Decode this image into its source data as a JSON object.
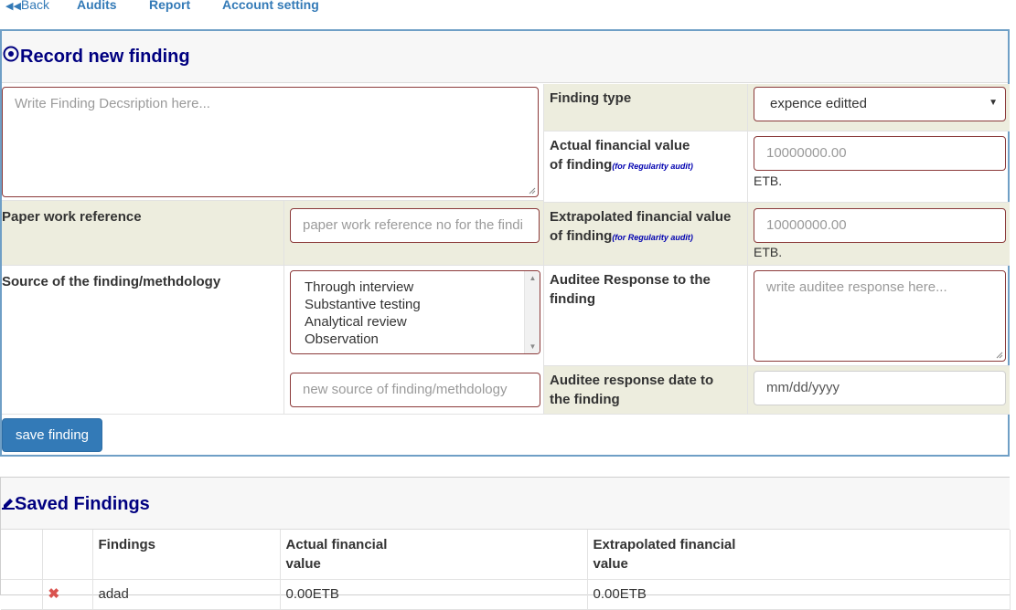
{
  "nav": {
    "back": "Back",
    "items": [
      "Audits",
      "Report",
      "Account setting"
    ]
  },
  "record": {
    "title": "Record new finding",
    "description_placeholder": "Write Finding Decsription here...",
    "finding_type_label": "Finding type",
    "finding_type_value": "expence editted",
    "actual_label_line1": "Actual financial value",
    "actual_label_line2": "of finding",
    "actual_note": "(for Regularity audit)",
    "actual_placeholder": "10000000.00",
    "currency": "ETB.",
    "extrapolated_label_line1": "Extrapolated financial value",
    "extrapolated_label_line2": "of finding",
    "extrapolated_note": "(for Regularity audit)",
    "extrapolated_placeholder": "10000000.00",
    "paper_label": "Paper work reference",
    "paper_placeholder": "paper work reference no for the findi",
    "source_label": "Source of the finding/methdology",
    "source_options": [
      "Through interview",
      "Substantive testing",
      "Analytical review",
      "Observation"
    ],
    "new_source_placeholder": "new source of finding/methdology",
    "response_label_line1": "Auditee Response to the",
    "response_label_line2": "finding",
    "response_placeholder": "write auditee response here...",
    "response_date_label_line1": "Auditee response date to",
    "response_date_label_line2": "the finding",
    "response_date_placeholder": "mm/dd/yyyy",
    "save_button": "save finding"
  },
  "saved": {
    "title": "Saved Findings",
    "columns": {
      "findings": "Findings",
      "actual_line1": "Actual financial",
      "actual_line2": "value",
      "extrapolated_line1": "Extrapolated financial",
      "extrapolated_line2": "value"
    },
    "rows": [
      {
        "finding": "adad",
        "actual": "0.00ETB",
        "extrapolated": "0.00ETB"
      }
    ]
  },
  "icons": {
    "back": "double-left-arrow-icon",
    "record": "radio-target-icon",
    "saved": "edit-pencil-icon",
    "select": "dropdown-caret-icon"
  }
}
